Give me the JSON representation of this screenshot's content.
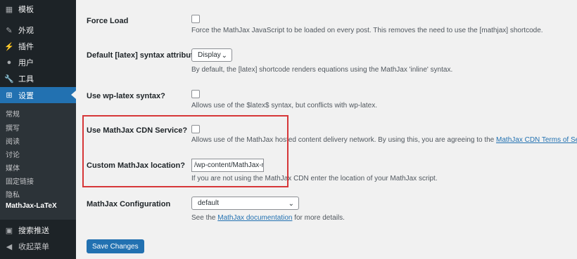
{
  "sidebar": {
    "menu": [
      {
        "label": "模板",
        "icon": "template-icon"
      },
      {
        "label": "外观",
        "icon": "brush-icon"
      },
      {
        "label": "插件",
        "icon": "plugin-icon"
      },
      {
        "label": "用户",
        "icon": "user-icon"
      },
      {
        "label": "工具",
        "icon": "wrench-icon"
      },
      {
        "label": "设置",
        "icon": "settings-icon"
      }
    ],
    "submenu": [
      "常规",
      "撰写",
      "阅读",
      "讨论",
      "媒体",
      "固定链接",
      "隐私",
      "MathJax-LaTeX"
    ],
    "menu_bottom": [
      {
        "label": "搜索推送",
        "icon": "search-push-icon"
      },
      {
        "label": "收起菜单",
        "icon": "collapse-icon"
      }
    ]
  },
  "settings": {
    "force_load": {
      "label": "Force Load",
      "description": "Force the MathJax JavaScript to be loaded on every post. This removes the need to use the [mathjax] shortcode."
    },
    "default_latex": {
      "label": "Default [latex] syntax attribute.",
      "value": "Display",
      "description": "By default, the [latex] shortcode renders equations using the MathJax 'inline' syntax."
    },
    "wp_latex": {
      "label": "Use wp-latex syntax?",
      "description": "Allows use of the $latex$ syntax, but conflicts with wp-latex."
    },
    "cdn": {
      "label": "Use MathJax CDN Service?",
      "description": "Allows use of the MathJax hosted content delivery network. By using this, you are agreeing to the ",
      "link": "MathJax CDN Terms of Service",
      "suffix": "."
    },
    "location": {
      "label": "Custom MathJax location?",
      "value": "/wp-content/MathJax-n",
      "description": "If you are not using the MathJax CDN enter the location of your MathJax script."
    },
    "config": {
      "label": "MathJax Configuration",
      "value": "default",
      "description_prefix": "See the ",
      "link": "MathJax documentation",
      "description_suffix": " for more details."
    }
  },
  "save_button": "Save Changes",
  "colors": {
    "accent": "#2271b1",
    "highlight_border": "#d63638",
    "sidebar_bg": "#1d2327"
  }
}
